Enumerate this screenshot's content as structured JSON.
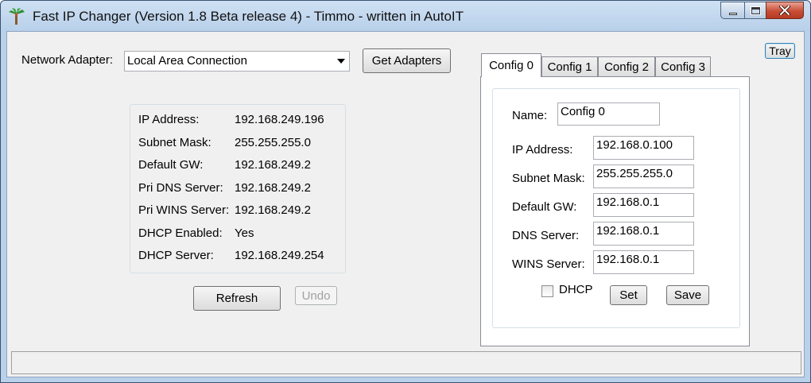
{
  "window": {
    "title": "Fast IP Changer (Version 1.8 Beta release 4) - Timmo - written in AutoIT"
  },
  "adapter": {
    "label": "Network Adapter:",
    "selected": "Local Area Connection",
    "get_adapters_label": "Get Adapters"
  },
  "tray_label": "Tray",
  "info": [
    {
      "label": "IP Address:",
      "value": "192.168.249.196"
    },
    {
      "label": "Subnet Mask:",
      "value": "255.255.255.0"
    },
    {
      "label": "Default GW:",
      "value": "192.168.249.2"
    },
    {
      "label": "Pri DNS Server:",
      "value": "192.168.249.2"
    },
    {
      "label": "Pri WINS Server:",
      "value": "192.168.249.2"
    },
    {
      "label": "DHCP Enabled:",
      "value": "Yes"
    },
    {
      "label": "DHCP Server:",
      "value": "192.168.249.254"
    }
  ],
  "actions": {
    "refresh_label": "Refresh",
    "undo_label": "Undo"
  },
  "tabs": [
    {
      "label": "Config 0",
      "active": true
    },
    {
      "label": "Config 1",
      "active": false
    },
    {
      "label": "Config 2",
      "active": false
    },
    {
      "label": "Config 3",
      "active": false
    }
  ],
  "config": {
    "name_label": "Name:",
    "name_value": "Config 0",
    "fields": [
      {
        "label": "IP Address:",
        "value": "192.168.0.100"
      },
      {
        "label": "Subnet Mask:",
        "value": "255.255.255.0"
      },
      {
        "label": "Default GW:",
        "value": "192.168.0.1"
      },
      {
        "label": "DNS Server:",
        "value": "192.168.0.1"
      },
      {
        "label": "WINS Server:",
        "value": "192.168.0.1"
      }
    ],
    "dhcp_label": "DHCP",
    "dhcp_checked": false,
    "set_label": "Set",
    "save_label": "Save"
  },
  "colors": {
    "frame": "#b9d1ea",
    "close_button": "#c74d36",
    "tray_border": "#3c7fb1"
  }
}
